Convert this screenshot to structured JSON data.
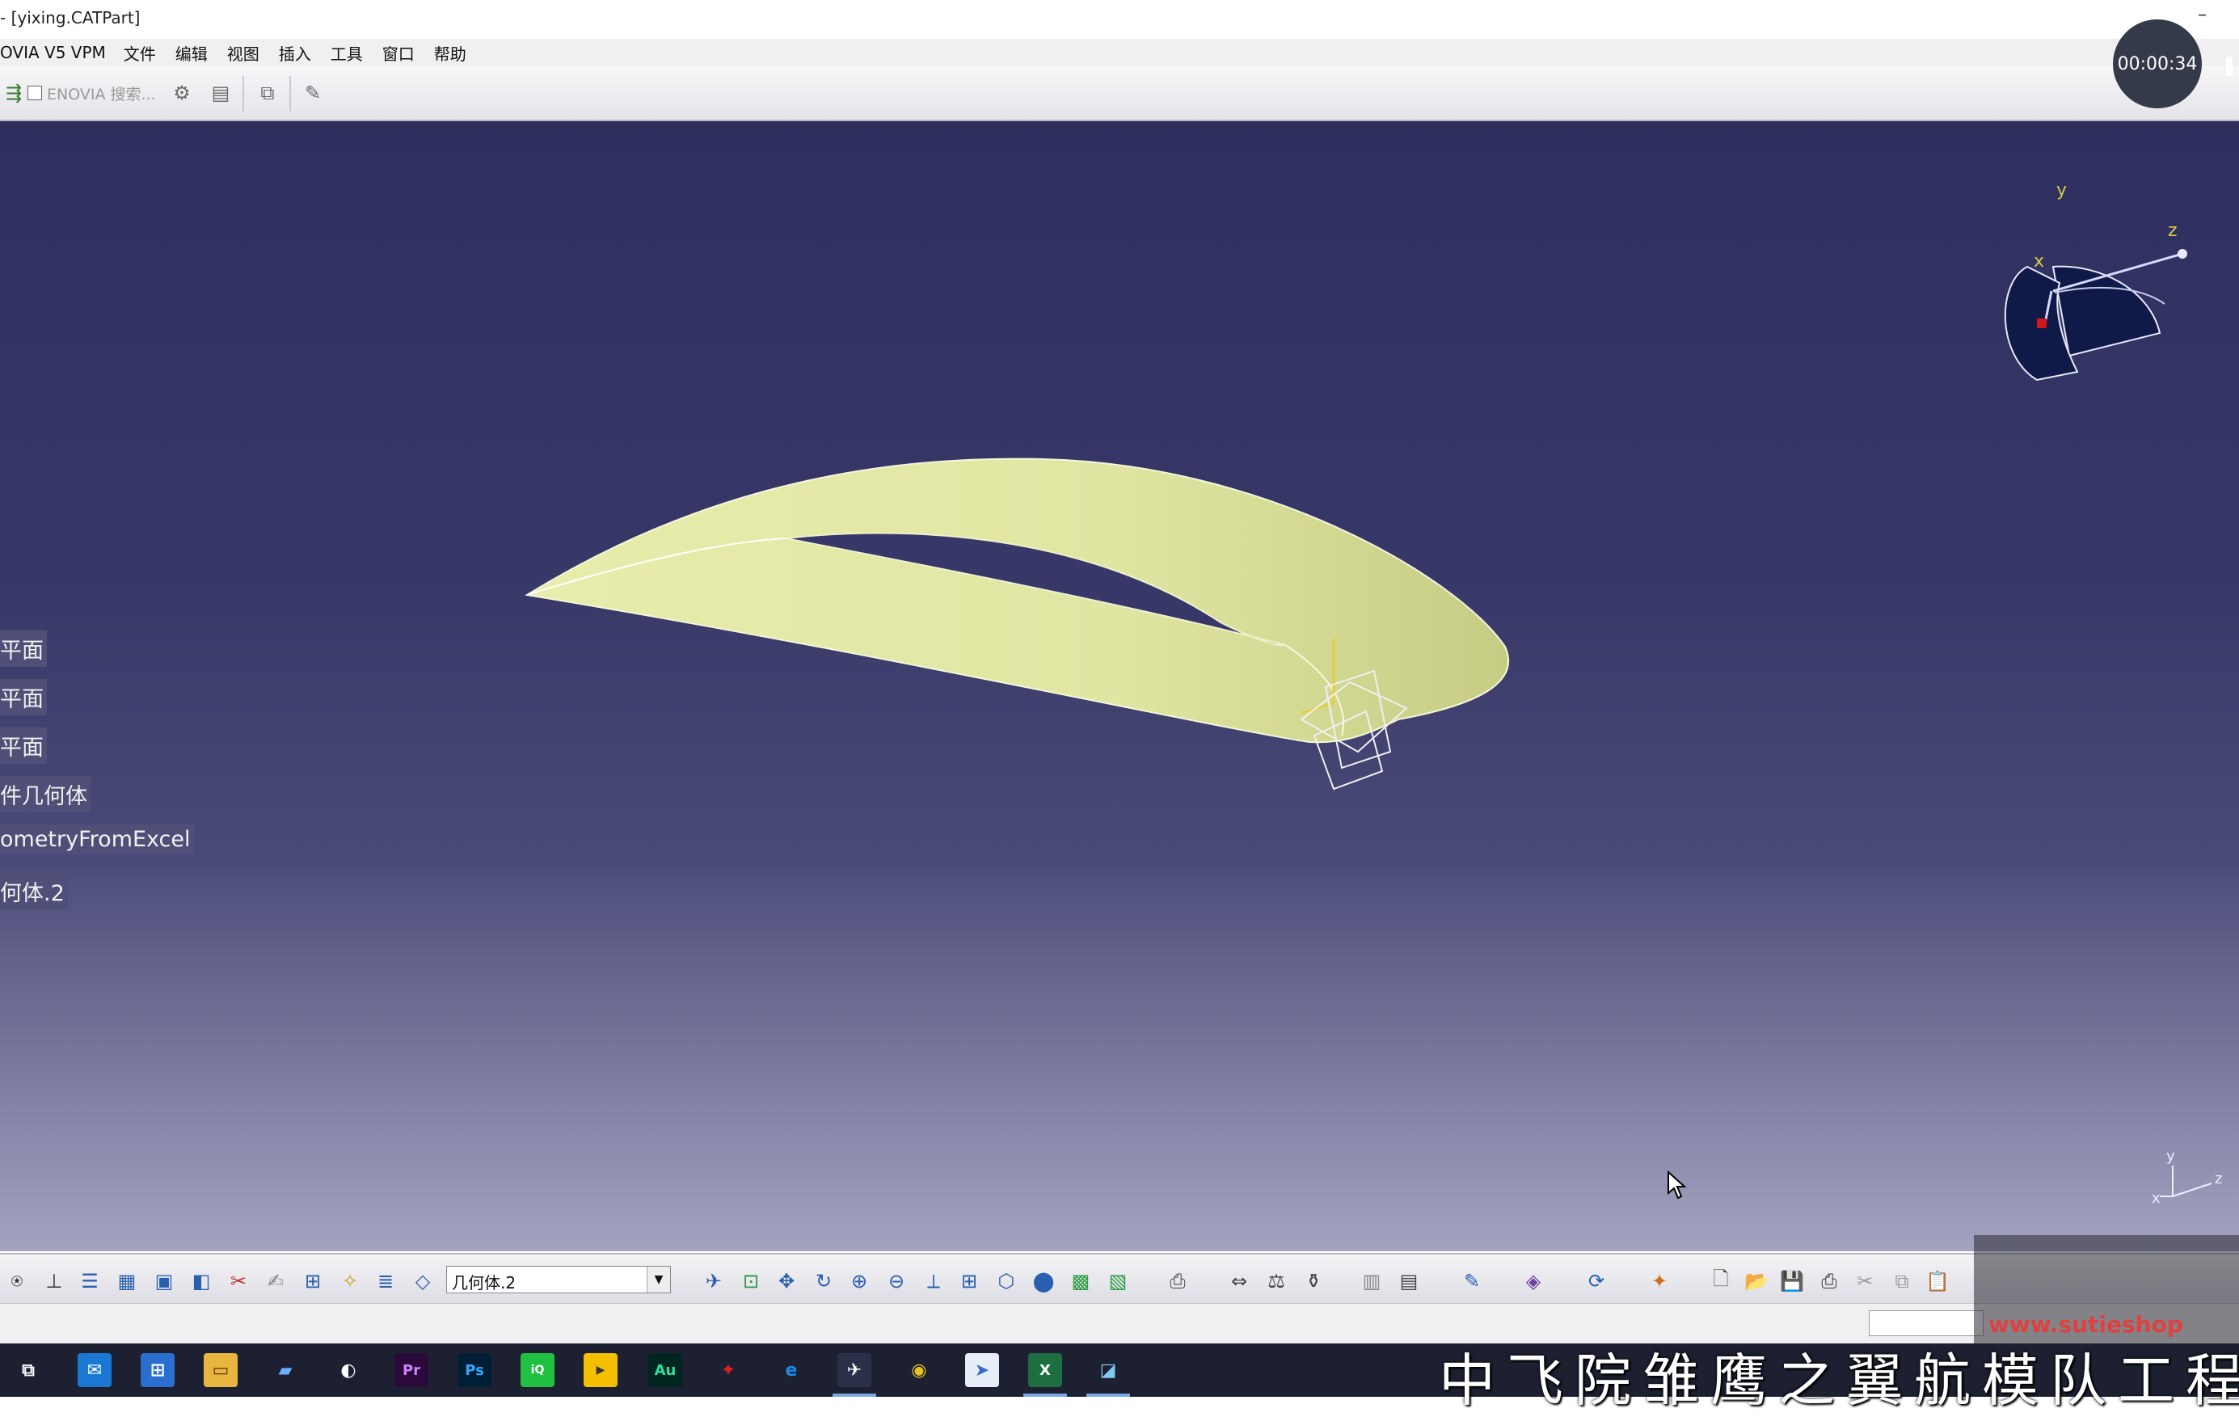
{
  "window": {
    "title": "- [yixing.CATPart]",
    "minimize_glyph": "–"
  },
  "menu": {
    "items": [
      "OVIA V5 VPM",
      "文件",
      "编辑",
      "视图",
      "插入",
      "工具",
      "窗口",
      "帮助"
    ]
  },
  "top_toolbar": {
    "enovia_search_label": "ENOVIA 搜索...",
    "icons": [
      "workbench-icon",
      "checkbox-icon",
      "search-options-icon",
      "document-icon",
      "transfer-icon",
      "checkout-icon"
    ]
  },
  "timer": {
    "text": "00:00:34"
  },
  "spec_tree": {
    "items": [
      "平面",
      "平面",
      "平面",
      "件几何体",
      "ometryFromExcel",
      "何体.2"
    ]
  },
  "compass": {
    "x_label": "x",
    "y_label": "y",
    "z_label": "z"
  },
  "axis_triad": {
    "y": "y",
    "z": "z",
    "x": "x"
  },
  "bottom_toolbar": {
    "geometry_dropdown_value": "几何体.2"
  },
  "subtitle": {
    "text": "中飞院雏鹰之翼航模队工程技"
  },
  "watermark": {
    "text": "www.sutieshop"
  },
  "colors": {
    "viewport_top": "#2e2e5f",
    "viewport_bottom": "#a3a3c0",
    "part_surface": "#e4e8a4",
    "compass_fill": "#0f1a48",
    "compass_axis": "#d8c84a"
  }
}
